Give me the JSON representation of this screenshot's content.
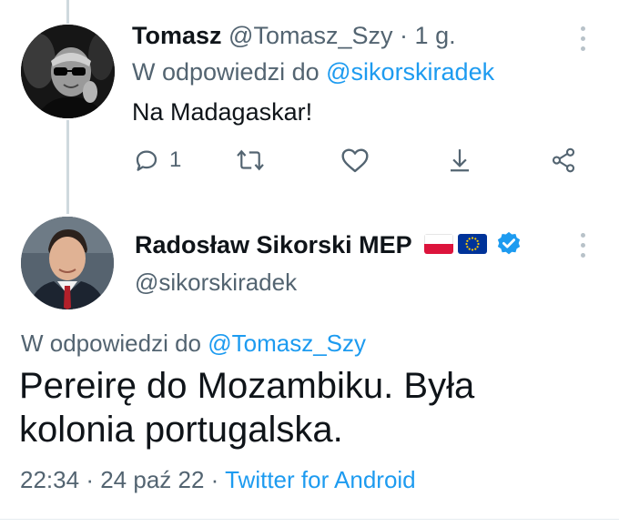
{
  "reply_tweet": {
    "author_name": "Tomasz",
    "author_handle": "@Tomasz_Szy",
    "separator": "·",
    "time": "1 g.",
    "reply_prefix": "W odpowiedzi do",
    "reply_target": "@sikorskiradek",
    "text": "Na Madagaskar!",
    "actions": {
      "reply_count": "1",
      "icons": [
        "reply-icon",
        "retweet-icon",
        "like-icon",
        "bookmark-icon",
        "share-icon"
      ]
    }
  },
  "main_tweet": {
    "author_name": "Radosław Sikorski MEP",
    "author_handle": "@sikorskiradek",
    "badges": [
      "flag-poland-icon",
      "flag-eu-icon",
      "verified-icon"
    ],
    "reply_prefix": "W odpowiedzi do",
    "reply_target": "@Tomasz_Szy",
    "text_line1": "Pereirę do Mozambiku. Była",
    "text_line2": "kolonia portugalska.",
    "time": "22:34",
    "separator": "·",
    "date": "24 paź 22",
    "separator2": "·",
    "source": "Twitter for Android"
  },
  "colors": {
    "accent": "#1d9bf0",
    "secondary_text": "#536471",
    "primary_text": "#0f1419",
    "thread_line": "#cfd9de"
  }
}
